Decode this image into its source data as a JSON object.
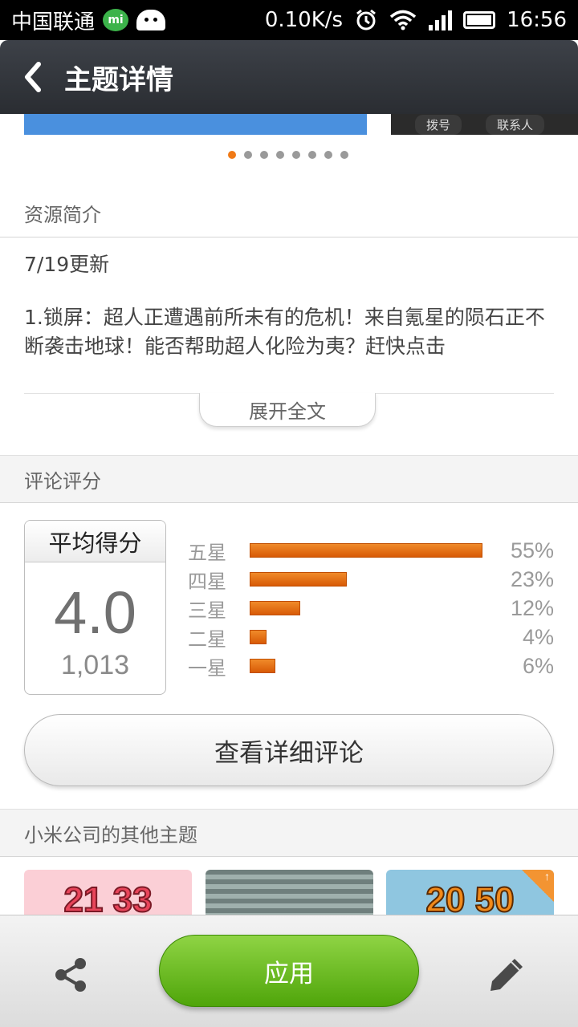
{
  "status_bar": {
    "carrier": "中国联通",
    "speed": "0.10K/s",
    "time": "16:56",
    "icons": [
      "mi-message-icon",
      "android-icon",
      "alarm-icon",
      "wifi-icon",
      "signal-icon",
      "battery-icon"
    ]
  },
  "header": {
    "title": "主题详情",
    "back_icon": "chevron-left-icon"
  },
  "preview": {
    "labels": [
      "拨号",
      "联系人"
    ],
    "page_count": 8,
    "active_page": 1,
    "accent": "#f07a17"
  },
  "intro_section": {
    "heading": "资源简介",
    "date": "7/19更新",
    "body": "1.锁屏：超人正遭遇前所未有的危机！来自氪星的陨石正不断袭击地球！能否帮助超人化险为夷？赶快点击",
    "expand_label": "展开全文"
  },
  "rating_section": {
    "heading": "评论评分",
    "average_label": "平均得分",
    "average": "4.0",
    "count": "1,013",
    "distribution": [
      {
        "label": "五星",
        "percent": 55,
        "text": "55%"
      },
      {
        "label": "四星",
        "percent": 23,
        "text": "23%"
      },
      {
        "label": "三星",
        "percent": 12,
        "text": "12%"
      },
      {
        "label": "二星",
        "percent": 4,
        "text": "4%"
      },
      {
        "label": "一星",
        "percent": 6,
        "text": "6%"
      }
    ],
    "detail_button": "查看详细评论",
    "bar_color": "#e4680c"
  },
  "other_themes": {
    "heading": "小米公司的其他主题",
    "items": [
      {
        "text": "21 33"
      },
      {
        "text": ""
      },
      {
        "text": "20 50"
      }
    ]
  },
  "bottom_bar": {
    "apply_label": "应用",
    "share_icon": "share-icon",
    "edit_icon": "pencil-icon",
    "accent": "#5cb314"
  }
}
